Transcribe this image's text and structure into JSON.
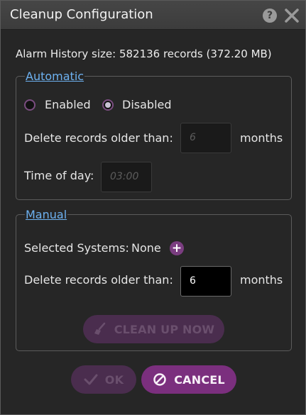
{
  "dialog": {
    "title": "Cleanup Configuration",
    "help_icon": "?",
    "summary": "Alarm History size: 582136 records (372.20 MB)"
  },
  "automatic": {
    "legend": "Automatic",
    "enabled_label": "Enabled",
    "disabled_label": "Disabled",
    "selected_option": "Disabled",
    "delete_label": "Delete records older than:",
    "delete_value": "6",
    "unit": "months",
    "time_label": "Time of day:",
    "time_value": "03:00"
  },
  "manual": {
    "legend": "Manual",
    "systems_label": "Selected Systems:",
    "systems_value": "None",
    "add_icon": "+",
    "delete_label": "Delete records older than:",
    "delete_value": "6",
    "unit": "months",
    "cleanup_button": "CLEAN UP NOW"
  },
  "footer": {
    "ok_button": "OK",
    "cancel_button": "CANCEL"
  },
  "colors": {
    "accent": "#7b2f7e",
    "link": "#6db1f0",
    "disabled_button": "#4a2d4e"
  }
}
